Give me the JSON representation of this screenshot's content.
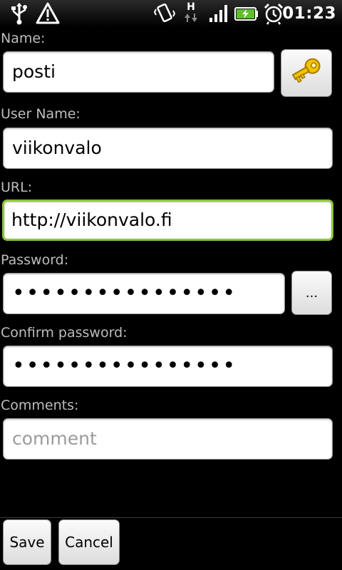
{
  "status_bar": {
    "icons": [
      "usb-icon",
      "warning-icon",
      "vibrate-icon",
      "hspa-data-icon",
      "signal-icon",
      "battery-charging-icon",
      "alarm-icon"
    ],
    "network_letter": "H",
    "time": "01:23"
  },
  "form": {
    "name": {
      "label": "Name:",
      "value": "posti"
    },
    "user_name": {
      "label": "User Name:",
      "value": "viikonvalo"
    },
    "url": {
      "label": "URL:",
      "value": "http://viikonvalo.fi"
    },
    "password": {
      "label": "Password:",
      "value": "••••••••••••••••"
    },
    "more_button_label": "...",
    "confirm_password": {
      "label": "Confirm password:",
      "value": "••••••••••••••••"
    },
    "comments": {
      "label": "Comments:",
      "placeholder": "comment"
    }
  },
  "actions": {
    "save_label": "Save",
    "cancel_label": "Cancel"
  },
  "colors": {
    "background": "#000000",
    "focus_border": "#8ac43a",
    "label_text": "#bdbdbd",
    "key_icon": "#f2c200"
  }
}
